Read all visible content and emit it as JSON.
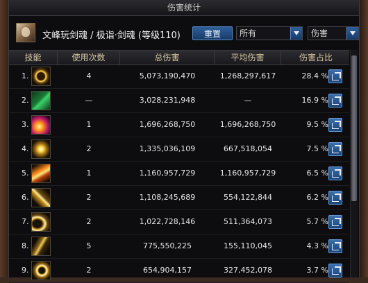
{
  "window": {
    "title": "伤害统计"
  },
  "character": {
    "name": "文峰玩剑魂 / 极诣·剑魂 (等级110)"
  },
  "controls": {
    "reset_label": "重置",
    "filter_select": "所有",
    "sort_select": "伤害"
  },
  "table": {
    "headers": [
      "技能",
      "使用次数",
      "总伤害",
      "平均伤害",
      "伤害占比"
    ],
    "rows": [
      {
        "rank": "1.",
        "uses": "4",
        "total": "5,073,190,470",
        "avg": "1,268,297,617",
        "pct": "28.4 %",
        "icon": "slash-ring-icon"
      },
      {
        "rank": "2.",
        "uses": "—",
        "total": "3,028,231,948",
        "avg": "—",
        "pct": "16.9 %",
        "icon": "sword-glyph-icon"
      },
      {
        "rank": "3.",
        "uses": "1",
        "total": "1,696,268,750",
        "avg": "1,696,268,750",
        "pct": "9.5 %",
        "icon": "flame-burst-icon"
      },
      {
        "rank": "4.",
        "uses": "2",
        "total": "1,335,036,109",
        "avg": "667,518,054",
        "pct": "7.5 %",
        "icon": "star-strike-icon"
      },
      {
        "rank": "5.",
        "uses": "1",
        "total": "1,160,957,729",
        "avg": "1,160,957,729",
        "pct": "6.5 %",
        "icon": "radiant-slash-icon"
      },
      {
        "rank": "6.",
        "uses": "2",
        "total": "1,108,245,689",
        "avg": "554,122,844",
        "pct": "6.2 %",
        "icon": "blade-sparks-icon"
      },
      {
        "rank": "7.",
        "uses": "2",
        "total": "1,022,728,146",
        "avg": "511,364,073",
        "pct": "5.7 %",
        "icon": "crescent-wave-icon"
      },
      {
        "rank": "8.",
        "uses": "5",
        "total": "775,550,225",
        "avg": "155,110,045",
        "pct": "4.3 %",
        "icon": "sword-rune-icon"
      },
      {
        "rank": "9.",
        "uses": "2",
        "total": "654,904,157",
        "avg": "327,452,078",
        "pct": "3.7 %",
        "icon": "golden-arc-icon"
      }
    ]
  }
}
